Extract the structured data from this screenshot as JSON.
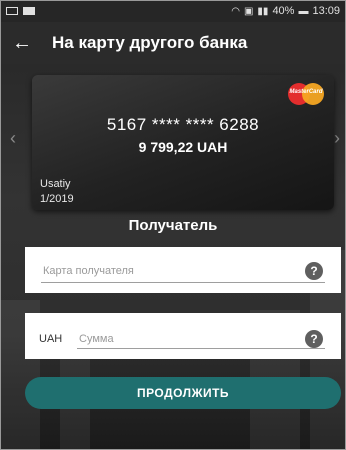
{
  "status_bar": {
    "battery": "40%",
    "time": "13:09"
  },
  "header": {
    "title": "На карту другого банка"
  },
  "card": {
    "number": "5167 **** **** 6288",
    "balance": "9 799,22 UAH",
    "holder": "Usatiy",
    "expiry": "1/2019",
    "brand": "MasterCard"
  },
  "recipient": {
    "heading": "Получатель",
    "card_placeholder": "Карта получателя"
  },
  "amount": {
    "currency": "UAH",
    "placeholder": "Сумма"
  },
  "actions": {
    "continue_label": "ПРОДОЛЖИТЬ"
  },
  "icons": {
    "back": "arrow-left-icon",
    "help": "question-icon",
    "prev": "chevron-left-icon",
    "next": "chevron-right-icon"
  },
  "colors": {
    "accent": "#1f6f6f",
    "background": "#1c1c1c"
  }
}
